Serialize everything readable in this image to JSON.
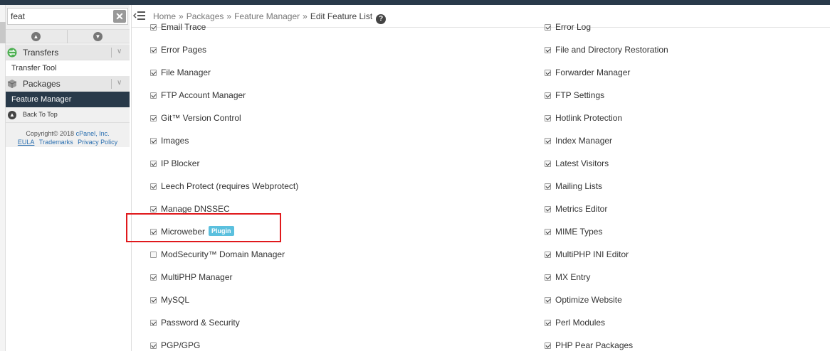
{
  "search": {
    "value": "feat",
    "clear_glyph": "✕"
  },
  "sidebar": {
    "sections": [
      {
        "label": "Transfers",
        "icon": "transfers-icon",
        "chevron": "∨"
      },
      {
        "label": "Packages",
        "icon": "packages-icon",
        "chevron": "∨"
      }
    ],
    "items": {
      "transfer_tool": "Transfer Tool",
      "feature_manager": "Feature Manager"
    },
    "back_to_top": "Back To Top",
    "copyright_prefix": "Copyright© 2018",
    "copyright_link": "cPanel, Inc.",
    "footer_links": [
      "EULA",
      "Trademarks",
      "Privacy Policy"
    ]
  },
  "breadcrumb": {
    "items": [
      "Home",
      "Packages",
      "Feature Manager"
    ],
    "separator": "»",
    "current": "Edit Feature List",
    "help_glyph": "?"
  },
  "features_left": [
    {
      "label": "Email Trace",
      "checked": true
    },
    {
      "label": "Error Pages",
      "checked": true
    },
    {
      "label": "File Manager",
      "checked": true
    },
    {
      "label": "FTP Account Manager",
      "checked": true
    },
    {
      "label": "Git™ Version Control",
      "checked": true
    },
    {
      "label": "Images",
      "checked": true
    },
    {
      "label": "IP Blocker",
      "checked": true
    },
    {
      "label": "Leech Protect (requires Webprotect)",
      "checked": true
    },
    {
      "label": "Manage DNSSEC",
      "checked": true
    },
    {
      "label": "Microweber",
      "checked": true,
      "badge": "Plugin"
    },
    {
      "label": "ModSecurity™ Domain Manager",
      "checked": false
    },
    {
      "label": "MultiPHP Manager",
      "checked": true
    },
    {
      "label": "MySQL",
      "checked": true
    },
    {
      "label": "Password & Security",
      "checked": true
    },
    {
      "label": "PGP/GPG",
      "checked": true
    }
  ],
  "features_right": [
    {
      "label": "Error Log",
      "checked": true
    },
    {
      "label": "File and Directory Restoration",
      "checked": true
    },
    {
      "label": "Forwarder Manager",
      "checked": true
    },
    {
      "label": "FTP Settings",
      "checked": true
    },
    {
      "label": "Hotlink Protection",
      "checked": true
    },
    {
      "label": "Index Manager",
      "checked": true
    },
    {
      "label": "Latest Visitors",
      "checked": true
    },
    {
      "label": "Mailing Lists",
      "checked": true
    },
    {
      "label": "Metrics Editor",
      "checked": true
    },
    {
      "label": "MIME Types",
      "checked": true
    },
    {
      "label": "MultiPHP INI Editor",
      "checked": true
    },
    {
      "label": "MX Entry",
      "checked": true
    },
    {
      "label": "Optimize Website",
      "checked": true
    },
    {
      "label": "Perl Modules",
      "checked": true
    },
    {
      "label": "PHP Pear Packages",
      "checked": true
    }
  ],
  "colors": {
    "topbar": "#293a4a",
    "active_item": "#293a4a",
    "plugin_badge": "#5bc0de",
    "highlight": "#e0191c",
    "link": "#2a6fb0"
  }
}
